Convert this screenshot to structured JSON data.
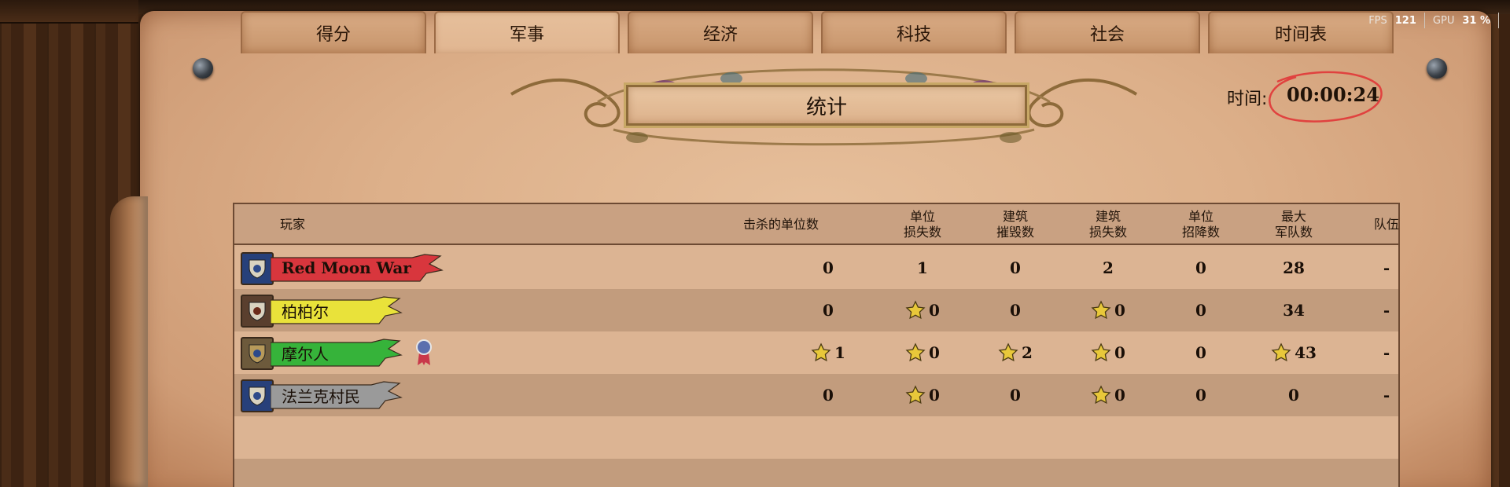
{
  "tabs": [
    "得分",
    "军事",
    "经济",
    "科技",
    "社会",
    "时间表"
  ],
  "active_tab": 1,
  "overlay": {
    "fps_label": "FPS",
    "fps_value": "121",
    "gpu_label": "GPU",
    "gpu_value": "31 %"
  },
  "title": "统计",
  "time": {
    "label": "时间:",
    "value": "00:00:24"
  },
  "headers": {
    "player": "玩家",
    "kills": "击杀的单位数",
    "unit_losses_1": "单位",
    "unit_losses_2": "损失数",
    "bldg_razed_1": "建筑",
    "bldg_razed_2": "摧毁数",
    "bldg_losses_1": "建筑",
    "bldg_losses_2": "损失数",
    "converted_1": "单位",
    "converted_2": "招降数",
    "max_army_1": "最大",
    "max_army_2": "军队数",
    "team": "队伍"
  },
  "players": [
    {
      "name": "Red Moon War",
      "banner_color": "#d8363d",
      "emblem": "fleur-de-lis-icon",
      "emblem_bg": "#27407a",
      "kills": "0",
      "kills_star": false,
      "unit_losses": "1",
      "unit_losses_star": false,
      "bldg_razed": "0",
      "bldg_razed_star": false,
      "bldg_losses": "2",
      "bldg_losses_star": false,
      "converted": "0",
      "max_army": "28",
      "max_army_star": false,
      "team": "-"
    },
    {
      "name": "柏柏尔",
      "banner_color": "#e9e23a",
      "emblem": "berber-symbol-icon",
      "emblem_bg": "#5a3f2e",
      "kills": "0",
      "kills_star": false,
      "unit_losses": "0",
      "unit_losses_star": true,
      "bldg_razed": "0",
      "bldg_razed_star": false,
      "bldg_losses": "0",
      "bldg_losses_star": true,
      "converted": "0",
      "max_army": "34",
      "max_army_star": false,
      "team": "-"
    },
    {
      "name": "摩尔人",
      "banner_color": "#36b33a",
      "emblem": "circle-sun-icon",
      "emblem_bg": "#6d5a3c",
      "kills": "1",
      "kills_star": true,
      "unit_losses": "0",
      "unit_losses_star": true,
      "bldg_razed": "2",
      "bldg_razed_star": true,
      "bldg_losses": "0",
      "bldg_losses_star": true,
      "converted": "0",
      "max_army": "43",
      "max_army_star": true,
      "team": "-",
      "medal": true
    },
    {
      "name": "法兰克村民",
      "banner_color": "#9a9a9a",
      "emblem": "fleur-de-lis-icon",
      "emblem_bg": "#27407a",
      "kills": "0",
      "kills_star": false,
      "unit_losses": "0",
      "unit_losses_star": true,
      "bldg_razed": "0",
      "bldg_razed_star": false,
      "bldg_losses": "0",
      "bldg_losses_star": true,
      "converted": "0",
      "max_army": "0",
      "max_army_star": false,
      "team": "-"
    }
  ]
}
